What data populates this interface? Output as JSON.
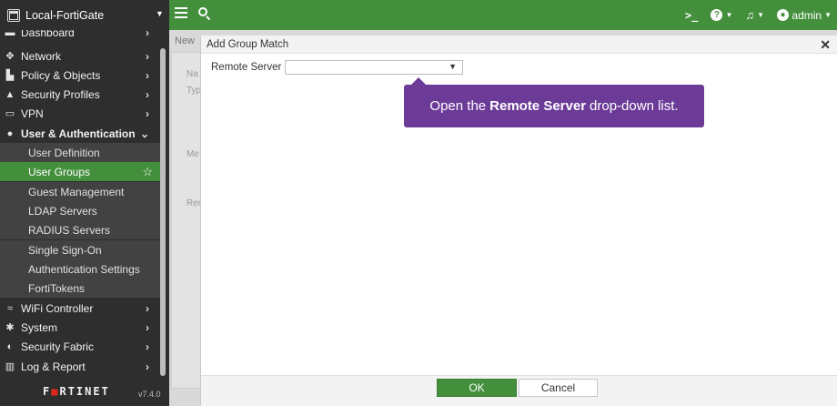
{
  "header": {
    "device_name": "Local-FortiGate",
    "user": "admin",
    "icons": [
      "hamburger-icon",
      "search-icon",
      "cli-icon",
      "help-icon",
      "bell-icon",
      "user-icon"
    ],
    "accent_color": "#438f3c"
  },
  "sidebar": {
    "dashboard": "Dashboard",
    "items": [
      {
        "label": "Network",
        "icon": "network-icon"
      },
      {
        "label": "Policy & Objects",
        "icon": "policy-icon"
      },
      {
        "label": "Security Profiles",
        "icon": "lock-icon"
      },
      {
        "label": "VPN",
        "icon": "monitor-icon"
      },
      {
        "label": "User & Authentication",
        "icon": "user-icon"
      }
    ],
    "sub_items": [
      "User Definition",
      "User Groups",
      "Guest Management",
      "LDAP Servers",
      "RADIUS Servers",
      "Single Sign-On",
      "Authentication Settings",
      "FortiTokens"
    ],
    "active_sub_item": "User Groups",
    "bottom_items": [
      {
        "label": "WiFi Controller",
        "icon": "wifi-icon"
      },
      {
        "label": "System",
        "icon": "gear-icon"
      },
      {
        "label": "Security Fabric",
        "icon": "fabric-icon"
      },
      {
        "label": "Log & Report",
        "icon": "chart-icon"
      }
    ],
    "logo": "FORTINET",
    "version": "v7.4.0"
  },
  "background": {
    "tab": "New",
    "labels": [
      "Na",
      "Typ",
      "Me",
      "Rer"
    ]
  },
  "dialog": {
    "title": "Add Group Match",
    "field_label": "Remote Server",
    "field_value": "",
    "ok_label": "OK",
    "cancel_label": "Cancel"
  },
  "callout": {
    "prefix": "Open the",
    "bold": "Remote Server",
    "suffix": "drop-down list.",
    "color": "#6c3b98"
  }
}
